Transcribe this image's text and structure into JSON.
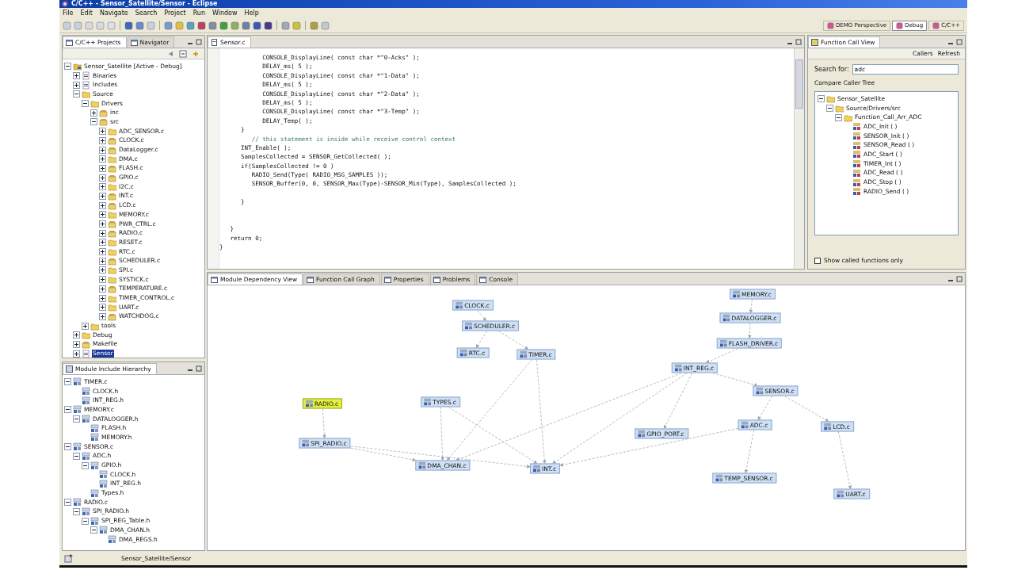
{
  "window": {
    "title": "C/C++ - Sensor_Satellite/Sensor - Eclipse"
  },
  "menu": [
    "File",
    "Edit",
    "Navigate",
    "Search",
    "Project",
    "Run",
    "Window",
    "Help"
  ],
  "perspectives": [
    {
      "label": "DEMO Perspective",
      "selected": false
    },
    {
      "label": "Debug",
      "selected": true
    },
    {
      "label": "C/C++",
      "selected": false
    }
  ],
  "explorer": {
    "tabs": [
      {
        "label": "C/C++ Projects",
        "selected": true
      },
      {
        "label": "Navigator",
        "selected": false
      }
    ],
    "tree": [
      {
        "label": "Sensor_Satellite [Active - Debug]",
        "kind": "project",
        "expanded": true,
        "selected": false,
        "children": [
          {
            "label": "Binaries",
            "kind": "binary",
            "expanded": false,
            "selected": false
          },
          {
            "label": "Includes",
            "kind": "binary",
            "expanded": false,
            "selected": false
          },
          {
            "label": "Source",
            "kind": "folder",
            "expanded": true,
            "selected": false,
            "children": [
              {
                "label": "Drivers",
                "kind": "folder",
                "expanded": true,
                "selected": false,
                "children": [
                  {
                    "label": "inc",
                    "kind": "file",
                    "expanded": false,
                    "selected": false
                  },
                  {
                    "label": "src",
                    "kind": "file",
                    "expanded": true,
                    "selected": false,
                    "children": [
                      {
                        "label": "ADC_SENSOR.c",
                        "kind": "folder",
                        "expanded": false,
                        "selected": false
                      },
                      {
                        "label": "CLOCK.c",
                        "kind": "file",
                        "expanded": false,
                        "selected": false
                      },
                      {
                        "label": "DataLogger.c",
                        "kind": "file",
                        "expanded": false,
                        "selected": false
                      },
                      {
                        "label": "DMA.c",
                        "kind": "folder",
                        "expanded": false,
                        "selected": false
                      },
                      {
                        "label": "FLASH.c",
                        "kind": "file",
                        "expanded": false,
                        "selected": false
                      },
                      {
                        "label": "GPIO.c",
                        "kind": "file",
                        "expanded": false,
                        "selected": false
                      },
                      {
                        "label": "I2C.c",
                        "kind": "folder",
                        "expanded": false,
                        "selected": false
                      },
                      {
                        "label": "INT.c",
                        "kind": "file",
                        "expanded": false,
                        "selected": false
                      },
                      {
                        "label": "LCD.c",
                        "kind": "file",
                        "expanded": false,
                        "selected": false
                      },
                      {
                        "label": "MEMORY.c",
                        "kind": "folder",
                        "expanded": false,
                        "selected": false
                      },
                      {
                        "label": "PWR_CTRL.c",
                        "kind": "file",
                        "expanded": false,
                        "selected": false
                      },
                      {
                        "label": "RADIO.c",
                        "kind": "file",
                        "expanded": false,
                        "selected": false
                      },
                      {
                        "label": "RESET.c",
                        "kind": "folder",
                        "expanded": false,
                        "selected": false
                      },
                      {
                        "label": "RTC.c",
                        "kind": "folder",
                        "expanded": false,
                        "selected": false
                      },
                      {
                        "label": "SCHEDULER.c",
                        "kind": "file",
                        "expanded": false,
                        "selected": false
                      },
                      {
                        "label": "SPI.c",
                        "kind": "folder",
                        "expanded": false,
                        "selected": false
                      },
                      {
                        "label": "SYSTICK.c",
                        "kind": "folder",
                        "expanded": false,
                        "selected": false
                      },
                      {
                        "label": "TEMPERATURE.c",
                        "kind": "file",
                        "expanded": false,
                        "selected": false
                      },
                      {
                        "label": "TIMER_CONTROL.c",
                        "kind": "folder",
                        "expanded": false,
                        "selected": false
                      },
                      {
                        "label": "UART.c",
                        "kind": "folder",
                        "expanded": false,
                        "selected": false
                      },
                      {
                        "label": "WATCHDOG.c",
                        "kind": "file",
                        "expanded": false,
                        "selected": false
                      }
                    ]
                  }
                ]
              },
              {
                "label": "tools",
                "kind": "folder",
                "expanded": false,
                "selected": false
              }
            ]
          },
          {
            "label": "Debug",
            "kind": "folder",
            "expanded": false,
            "selected": false
          },
          {
            "label": "Makefile",
            "kind": "file",
            "expanded": false,
            "selected": false
          },
          {
            "label": "Sensor",
            "kind": "binary",
            "expanded": false,
            "selected": true
          }
        ]
      }
    ]
  },
  "hierarchy": {
    "tab": "Module Include Hierarchy",
    "tree": [
      {
        "label": "TIMER.c",
        "kind": "module",
        "expanded": true,
        "children": [
          {
            "label": "CLOCK.h",
            "kind": "module"
          },
          {
            "label": "INT_REG.h",
            "kind": "module"
          }
        ]
      },
      {
        "label": "MEMORY.c",
        "kind": "module",
        "expanded": true,
        "children": [
          {
            "label": "DATALOGGER.h",
            "kind": "module",
            "expanded": true,
            "children": [
              {
                "label": "FLASH.h",
                "kind": "module"
              },
              {
                "label": "MEMORY.h",
                "kind": "module"
              }
            ]
          }
        ]
      },
      {
        "label": "SENSOR.c",
        "kind": "module",
        "expanded": true,
        "children": [
          {
            "label": "ADC.h",
            "kind": "module",
            "expanded": true,
            "children": [
              {
                "label": "GPIO.h",
                "kind": "module",
                "expanded": true,
                "children": [
                  {
                    "label": "CLOCK.h",
                    "kind": "module"
                  },
                  {
                    "label": "INT_REG.h",
                    "kind": "module"
                  }
                ]
              },
              {
                "label": "Types.h",
                "kind": "module"
              }
            ]
          }
        ]
      },
      {
        "label": "RADIO.c",
        "kind": "module",
        "expanded": true,
        "children": [
          {
            "label": "SPI_RADIO.h",
            "kind": "module",
            "expanded": true,
            "children": [
              {
                "label": "SPI_REG_Table.h",
                "kind": "module",
                "expanded": true,
                "children": [
                  {
                    "label": "DMA_CHAN.h",
                    "kind": "module",
                    "expanded": true,
                    "children": [
                      {
                        "label": "DMA_REGS.h",
                        "kind": "module"
                      }
                    ]
                  }
                ]
              }
            ]
          }
        ]
      }
    ]
  },
  "editor": {
    "tab": "Sensor.c",
    "lines": [
      {
        "kind": "code",
        "text": "            CONSOLE_DisplayLine( const char *\"0-Acks\" );"
      },
      {
        "kind": "code",
        "text": "            DELAY_ms( 5 );"
      },
      {
        "kind": "code",
        "text": "            CONSOLE_DisplayLine( const char *\"1-Data\" );"
      },
      {
        "kind": "code",
        "text": "            DELAY_ms( 5 );"
      },
      {
        "kind": "code",
        "text": "            CONSOLE_DisplayLine( const char *\"2-Data\" );"
      },
      {
        "kind": "code",
        "text": "            DELAY_ms( 5 );"
      },
      {
        "kind": "code",
        "text": "            CONSOLE_DisplayLine( const char *\"3-Temp\" );"
      },
      {
        "kind": "code",
        "text": "            DELAY_Temp( );"
      },
      {
        "kind": "code",
        "text": "      }"
      },
      {
        "kind": "comment",
        "text": "         // this statement is inside while receive control context"
      },
      {
        "kind": "code",
        "text": "      INT_Enable( );"
      },
      {
        "kind": "code",
        "text": "      SamplesCollected = SENSOR_GetCollected( );"
      },
      {
        "kind": "code",
        "text": "      if(SamplesCollected != 0 )"
      },
      {
        "kind": "code",
        "text": "         RADIO_Send(Type( RADIO_MSG_SAMPLES ));"
      },
      {
        "kind": "code",
        "text": "         SENSOR_Buffer(0, 0, SENSOR_Max(Type)-SENSOR_Min(Type), SamplesCollected );"
      },
      {
        "kind": "blank"
      },
      {
        "kind": "code",
        "text": "      }"
      },
      {
        "kind": "blank"
      },
      {
        "kind": "blank"
      },
      {
        "kind": "code",
        "text": "   }"
      },
      {
        "kind": "code",
        "text": "   return 0;"
      },
      {
        "kind": "code",
        "text": "}"
      }
    ]
  },
  "call_view": {
    "tab": "Function Call View",
    "filter": "Callers",
    "refresh": "Refresh",
    "search_label": "Search for:",
    "search_value": "adc",
    "tree_label": "Compare Caller Tree",
    "tree": [
      {
        "label": "Sensor_Satellite",
        "kind": "folder",
        "expanded": true,
        "children": [
          {
            "label": "Source/Drivers/src",
            "kind": "folder",
            "expanded": true,
            "children": [
              {
                "label": "Function_Call_Arr_ADC",
                "kind": "folder",
                "expanded": true,
                "children": [
                  {
                    "label": "ADC_Init ( )",
                    "kind": "function"
                  },
                  {
                    "label": "SENSOR_Init ( )",
                    "kind": "function"
                  },
                  {
                    "label": "SENSOR_Read ( )",
                    "kind": "function"
                  },
                  {
                    "label": "ADC_Start ( )",
                    "kind": "function"
                  },
                  {
                    "label": "TIMER_Int ( )",
                    "kind": "function"
                  },
                  {
                    "label": "ADC_Read ( )",
                    "kind": "function"
                  },
                  {
                    "label": "ADC_Stop ( )",
                    "kind": "function"
                  },
                  {
                    "label": "RADIO_Send ( )",
                    "kind": "function"
                  }
                ]
              }
            ]
          }
        ]
      }
    ],
    "checkbox": {
      "label": "Show called functions only",
      "checked": false
    }
  },
  "graph_view": {
    "tabs": [
      {
        "label": "Module Dependency View",
        "selected": true
      },
      {
        "label": "Function Call Graph",
        "selected": false
      },
      {
        "label": "Properties",
        "selected": false
      },
      {
        "label": "Problems",
        "selected": false
      },
      {
        "label": "Console",
        "selected": false
      }
    ],
    "nodes": [
      {
        "label": "CLOCK.c",
        "highlighted": false
      },
      {
        "label": "SCHEDULER.c",
        "highlighted": false
      },
      {
        "label": "RTC.c",
        "highlighted": false
      },
      {
        "label": "TIMER.c",
        "highlighted": false
      },
      {
        "label": "MEMORY.c",
        "highlighted": false
      },
      {
        "label": "DATALOGGER.c",
        "highlighted": false
      },
      {
        "label": "FLASH_DRIVER.c",
        "highlighted": false
      },
      {
        "label": "INT_REG.c",
        "highlighted": false
      },
      {
        "label": "SENSOR.c",
        "highlighted": false
      },
      {
        "label": "RADIO.c",
        "highlighted": true
      },
      {
        "label": "TYPES.c",
        "highlighted": false
      },
      {
        "label": "SPI_RADIO.c",
        "highlighted": false
      },
      {
        "label": "GPIO_PORT.c",
        "highlighted": false
      },
      {
        "label": "ADC.c",
        "highlighted": false
      },
      {
        "label": "LCD.c",
        "highlighted": false
      },
      {
        "label": "DMA_CHAN.c",
        "highlighted": false
      },
      {
        "label": "INT.c",
        "highlighted": false
      },
      {
        "label": "TEMP_SENSOR.c",
        "highlighted": false
      },
      {
        "label": "UART.c",
        "highlighted": false
      }
    ]
  },
  "status_bar": {
    "text": "Sensor_Satellite/Sensor"
  }
}
